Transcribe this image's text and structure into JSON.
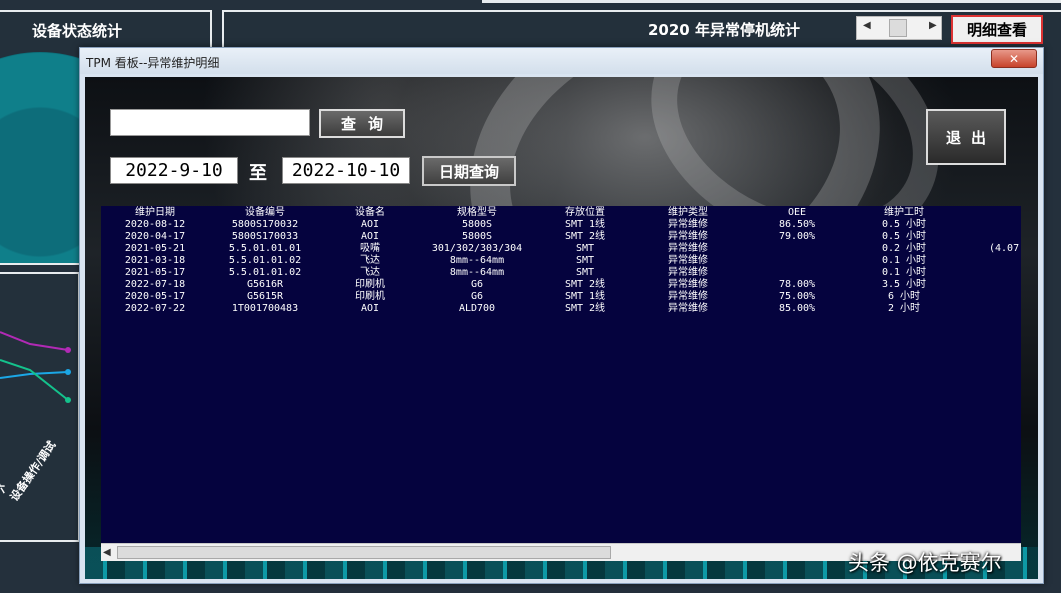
{
  "background": {
    "left_panel_title": "设备状态统计",
    "right_panel_title": "2020  年异常停机统计",
    "detail_button": "明细查看",
    "axis_label": "设备操作/调试",
    "axis_label_2": "六"
  },
  "dialog": {
    "title": "TPM 看板--异常维护明细",
    "close_label": "✕",
    "search": {
      "value": "",
      "placeholder": ""
    },
    "query_button": "查询",
    "exit_button": "退出",
    "date_from": "2022-9-10",
    "date_separator": "至",
    "date_to": "2022-10-10",
    "date_query_button": "日期查询"
  },
  "table": {
    "columns": [
      "维护日期",
      "设备编号",
      "设备名",
      "规格型号",
      "存放位置",
      "维护类型",
      "OEE",
      "维护工时",
      ""
    ],
    "rows": [
      [
        "2020-08-12",
        "5800S170032",
        "AOI",
        "5800S",
        "SMT 1线",
        "异常维修",
        "86.50%",
        "0.5 小时",
        ""
      ],
      [
        "2020-04-17",
        "5800S170033",
        "AOI",
        "5800S",
        "SMT 2线",
        "异常维修",
        "79.00%",
        "0.5 小时",
        ""
      ],
      [
        "2021-05-21",
        "5.5.01.01.01",
        "吸嘴",
        "301/302/303/304",
        "SMT",
        "异常维修",
        "",
        "0.2 小时",
        "(4.07"
      ],
      [
        "2021-03-18",
        "5.5.01.01.02",
        "飞达",
        "8mm--64mm",
        "SMT",
        "异常维修",
        "",
        "0.1 小时",
        ""
      ],
      [
        "2021-05-17",
        "5.5.01.01.02",
        "飞达",
        "8mm--64mm",
        "SMT",
        "异常维修",
        "",
        "0.1 小时",
        ""
      ],
      [
        "2022-07-18",
        "G5616R",
        "印刷机",
        "G6",
        "SMT 2线",
        "异常维修",
        "78.00%",
        "3.5 小时",
        ""
      ],
      [
        "2020-05-17",
        "G5615R",
        "印刷机",
        "G6",
        "SMT 1线",
        "异常维修",
        "75.00%",
        "6 小时",
        ""
      ],
      [
        "2022-07-22",
        "1T001700483",
        "AOI",
        "ALD700",
        "SMT 2线",
        "异常维修",
        "85.00%",
        "2 小时",
        ""
      ]
    ]
  },
  "watermark": "头条 @依克赛尔"
}
